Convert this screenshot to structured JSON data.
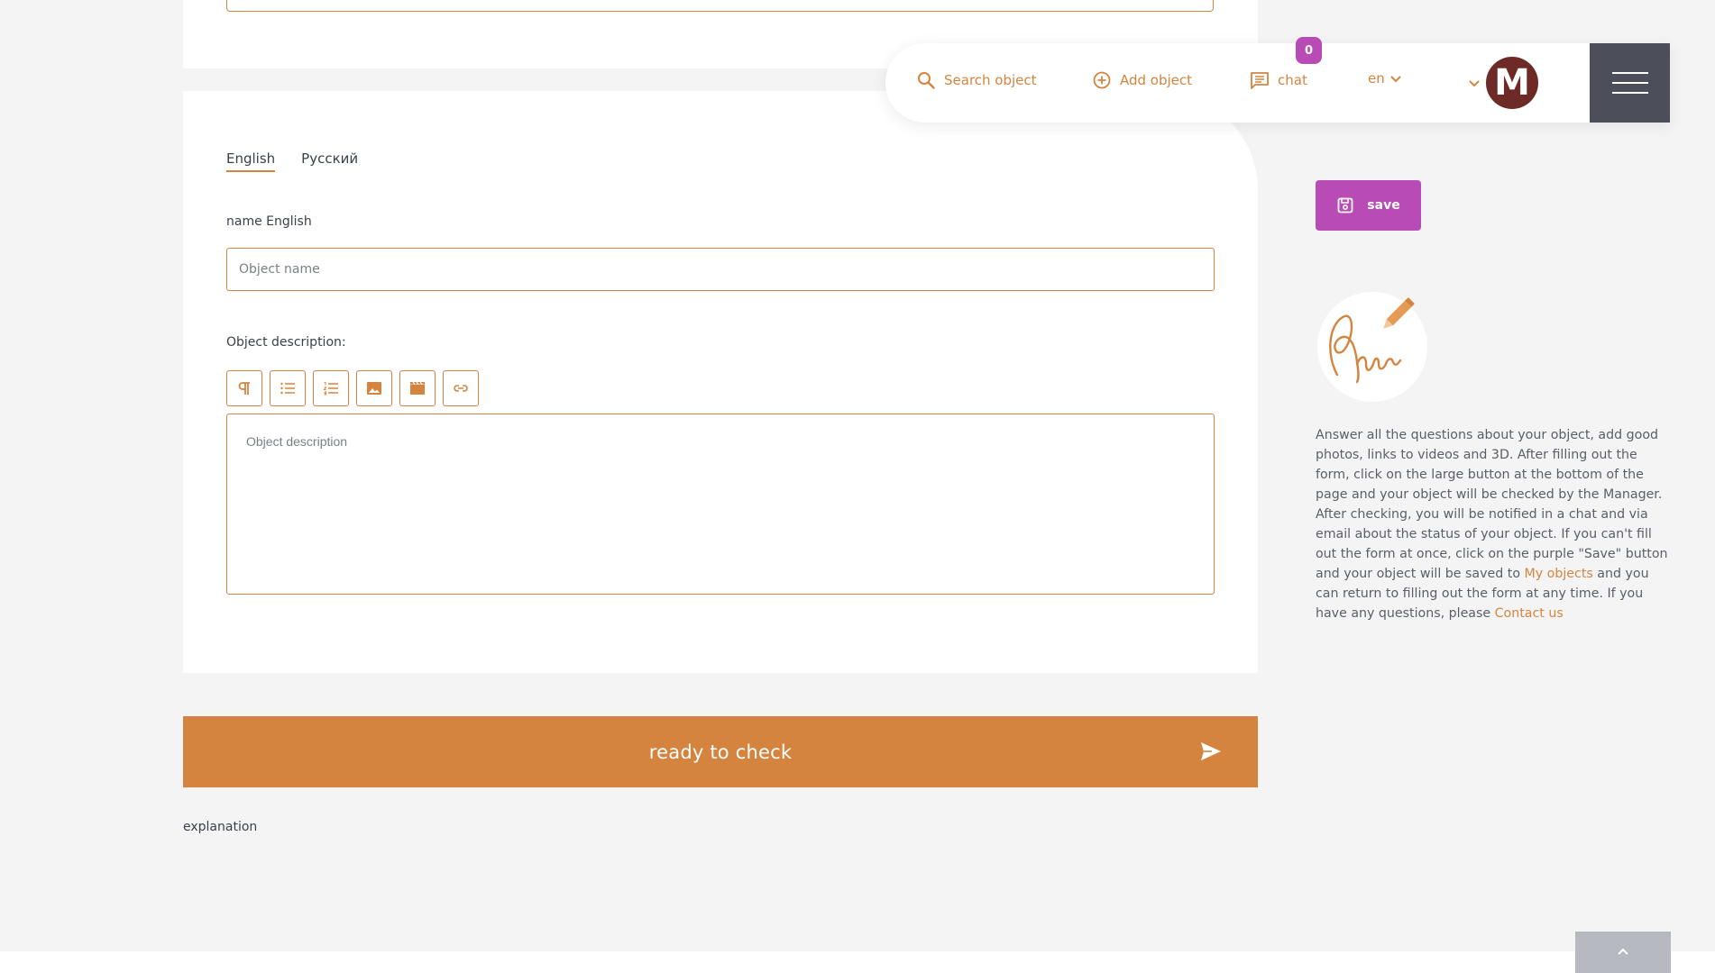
{
  "nav": {
    "search_label": "Search object",
    "add_label": "Add object",
    "chat_label": "chat",
    "chat_count": "0",
    "language": "en",
    "avatar_letter": "M"
  },
  "form": {
    "tabs": [
      "English",
      "Русский"
    ],
    "name_label": "name English",
    "name_placeholder": "Object name",
    "description_label": "Object description:",
    "description_placeholder": "Object description",
    "toolbar_icons": [
      "paragraph-icon",
      "bulleted-list-icon",
      "numbered-list-icon",
      "image-icon",
      "video-icon",
      "link-icon"
    ]
  },
  "submit": {
    "ready_label": "ready to check",
    "explanation": "explanation"
  },
  "sidebar": {
    "save_label": "save",
    "help_part1": "Answer all the questions about your object, add good photos, links to videos and 3D. After filling out the form, click on the large button at the bottom of the page and your object will be checked by the Manager. After checking, you will be notified in a chat and via email about the status of your object. If you can't fill out the form at once, click on the purple \"Save\" button and your object will be saved to ",
    "help_link1": "My objects",
    "help_part2": " and you can return to filling out the form at any time. If you have any questions, please ",
    "help_link2": "Contact us"
  },
  "colors": {
    "accent": "#d5843f",
    "purple": "#b84bb5",
    "menu": "#4c4e59",
    "avatar": "#6e2a26"
  }
}
